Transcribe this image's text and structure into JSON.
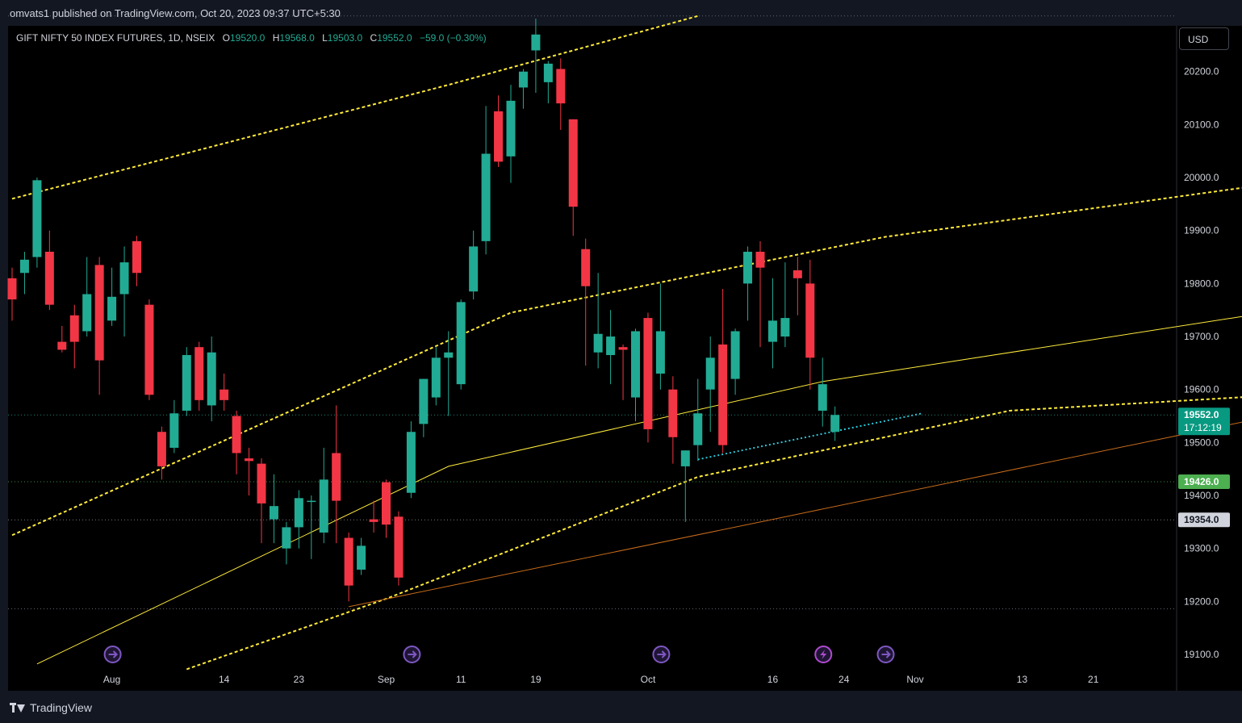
{
  "header": {
    "publisher": "omvats1 published on TradingView.com, Oct 20, 2023 09:37 UTC+5:30"
  },
  "legend": {
    "symbol": "GIFT NIFTY 50 INDEX FUTURES, 1D, NSEIX",
    "o_label": "O",
    "o": "19520.0",
    "h_label": "H",
    "h": "19568.0",
    "l_label": "L",
    "l": "19503.0",
    "c_label": "C",
    "c": "19552.0",
    "change": "−59.0 (−0.30%)"
  },
  "toolbar": {
    "currency": "USD"
  },
  "footer": {
    "brand": "TradingView"
  },
  "colors": {
    "up": "#22ab94",
    "down": "#f23645",
    "background": "#000000",
    "frame": "#131722",
    "channel": "#ffeb3b",
    "trend_cyan": "#2ec4d6",
    "trend_orange": "#c76b1a"
  },
  "chart_data": {
    "type": "candlestick",
    "title": "GIFT NIFTY 50 INDEX FUTURES, 1D, NSEIX",
    "ylim": [
      19055,
      20320
    ],
    "y_ticks": [
      19100,
      19200,
      19300,
      19400,
      19500,
      19600,
      19700,
      19800,
      19900,
      20000,
      20100,
      20200
    ],
    "y_tick_labels": [
      "19100.0",
      "19200.0",
      "19300.0",
      "19400.0",
      "19500.0",
      "19600.0",
      "19700.0",
      "19800.0",
      "19900.0",
      "20000.0",
      "20100.0",
      "20200.0"
    ],
    "x_tick_labels": [
      {
        "label": "Aug",
        "date": "2023-08-01"
      },
      {
        "label": "14",
        "date": "2023-08-14"
      },
      {
        "label": "23",
        "date": "2023-08-23"
      },
      {
        "label": "Sep",
        "date": "2023-09-01"
      },
      {
        "label": "11",
        "date": "2023-09-11"
      },
      {
        "label": "19",
        "date": "2023-09-19"
      },
      {
        "label": "Oct",
        "date": "2023-10-02"
      },
      {
        "label": "16",
        "date": "2023-10-16"
      },
      {
        "label": "24",
        "date": "2023-10-24"
      },
      {
        "label": "Nov",
        "date": "2023-11-01"
      },
      {
        "label": "13",
        "date": "2023-11-13"
      },
      {
        "label": "21",
        "date": "2023-11-21"
      }
    ],
    "candles": [
      {
        "date": "2023-07-20",
        "o": 19810,
        "h": 19830,
        "l": 19730,
        "c": 19770
      },
      {
        "date": "2023-07-21",
        "o": 19820,
        "h": 19860,
        "l": 19780,
        "c": 19845
      },
      {
        "date": "2023-07-24",
        "o": 19850,
        "h": 20000,
        "l": 19830,
        "c": 19995
      },
      {
        "date": "2023-07-25",
        "o": 19860,
        "h": 19900,
        "l": 19750,
        "c": 19760
      },
      {
        "date": "2023-07-26",
        "o": 19690,
        "h": 19720,
        "l": 19670,
        "c": 19675
      },
      {
        "date": "2023-07-27",
        "o": 19740,
        "h": 19760,
        "l": 19640,
        "c": 19690
      },
      {
        "date": "2023-07-28",
        "o": 19710,
        "h": 19850,
        "l": 19700,
        "c": 19780
      },
      {
        "date": "2023-07-31",
        "o": 19835,
        "h": 19850,
        "l": 19590,
        "c": 19655
      },
      {
        "date": "2023-08-01",
        "o": 19730,
        "h": 19830,
        "l": 19720,
        "c": 19775
      },
      {
        "date": "2023-08-02",
        "o": 19780,
        "h": 19870,
        "l": 19700,
        "c": 19840
      },
      {
        "date": "2023-08-03",
        "o": 19880,
        "h": 19890,
        "l": 19795,
        "c": 19820
      },
      {
        "date": "2023-08-04",
        "o": 19760,
        "h": 19770,
        "l": 19580,
        "c": 19590
      },
      {
        "date": "2023-08-07",
        "o": 19520,
        "h": 19530,
        "l": 19430,
        "c": 19455
      },
      {
        "date": "2023-08-08",
        "o": 19490,
        "h": 19580,
        "l": 19480,
        "c": 19555
      },
      {
        "date": "2023-08-09",
        "o": 19560,
        "h": 19680,
        "l": 19550,
        "c": 19665
      },
      {
        "date": "2023-08-10",
        "o": 19680,
        "h": 19690,
        "l": 19560,
        "c": 19580
      },
      {
        "date": "2023-08-11",
        "o": 19570,
        "h": 19700,
        "l": 19540,
        "c": 19670
      },
      {
        "date": "2023-08-14",
        "o": 19600,
        "h": 19630,
        "l": 19560,
        "c": 19580
      },
      {
        "date": "2023-08-16",
        "o": 19550,
        "h": 19560,
        "l": 19440,
        "c": 19480
      },
      {
        "date": "2023-08-17",
        "o": 19470,
        "h": 19490,
        "l": 19400,
        "c": 19465
      },
      {
        "date": "2023-08-18",
        "o": 19460,
        "h": 19470,
        "l": 19310,
        "c": 19385
      },
      {
        "date": "2023-08-21",
        "o": 19355,
        "h": 19440,
        "l": 19310,
        "c": 19380
      },
      {
        "date": "2023-08-22",
        "o": 19300,
        "h": 19350,
        "l": 19270,
        "c": 19340
      },
      {
        "date": "2023-08-23",
        "o": 19340,
        "h": 19410,
        "l": 19300,
        "c": 19395
      },
      {
        "date": "2023-08-24",
        "o": 19390,
        "h": 19400,
        "l": 19280,
        "c": 19390
      },
      {
        "date": "2023-08-25",
        "o": 19330,
        "h": 19490,
        "l": 19310,
        "c": 19430
      },
      {
        "date": "2023-08-28",
        "o": 19480,
        "h": 19570,
        "l": 19310,
        "c": 19390
      },
      {
        "date": "2023-08-29",
        "o": 19320,
        "h": 19330,
        "l": 19200,
        "c": 19230
      },
      {
        "date": "2023-08-30",
        "o": 19260,
        "h": 19320,
        "l": 19250,
        "c": 19305
      },
      {
        "date": "2023-08-31",
        "o": 19355,
        "h": 19390,
        "l": 19330,
        "c": 19350
      },
      {
        "date": "2023-09-01",
        "o": 19425,
        "h": 19430,
        "l": 19320,
        "c": 19345
      },
      {
        "date": "2023-09-04",
        "o": 19360,
        "h": 19370,
        "l": 19230,
        "c": 19245
      },
      {
        "date": "2023-09-05",
        "o": 19405,
        "h": 19540,
        "l": 19395,
        "c": 19520
      },
      {
        "date": "2023-09-06",
        "o": 19535,
        "h": 19620,
        "l": 19510,
        "c": 19620
      },
      {
        "date": "2023-09-07",
        "o": 19585,
        "h": 19680,
        "l": 19570,
        "c": 19660
      },
      {
        "date": "2023-09-08",
        "o": 19660,
        "h": 19710,
        "l": 19550,
        "c": 19670
      },
      {
        "date": "2023-09-11",
        "o": 19610,
        "h": 19770,
        "l": 19600,
        "c": 19765
      },
      {
        "date": "2023-09-12",
        "o": 19785,
        "h": 19900,
        "l": 19770,
        "c": 19870
      },
      {
        "date": "2023-09-13",
        "o": 19880,
        "h": 20135,
        "l": 19855,
        "c": 20045
      },
      {
        "date": "2023-09-14",
        "o": 20125,
        "h": 20155,
        "l": 20020,
        "c": 20030
      },
      {
        "date": "2023-09-15",
        "o": 20040,
        "h": 20175,
        "l": 19990,
        "c": 20145
      },
      {
        "date": "2023-09-18",
        "o": 20170,
        "h": 20205,
        "l": 20130,
        "c": 20200
      },
      {
        "date": "2023-09-19",
        "o": 20240,
        "h": 20300,
        "l": 20160,
        "c": 20270
      },
      {
        "date": "2023-09-20",
        "o": 20180,
        "h": 20220,
        "l": 20140,
        "c": 20215
      },
      {
        "date": "2023-09-21",
        "o": 20205,
        "h": 20225,
        "l": 20090,
        "c": 20140
      },
      {
        "date": "2023-09-22",
        "o": 20110,
        "h": 20110,
        "l": 19890,
        "c": 19945
      },
      {
        "date": "2023-09-25",
        "o": 19865,
        "h": 19885,
        "l": 19645,
        "c": 19795
      },
      {
        "date": "2023-09-26",
        "o": 19670,
        "h": 19820,
        "l": 19640,
        "c": 19705
      },
      {
        "date": "2023-09-27",
        "o": 19665,
        "h": 19750,
        "l": 19610,
        "c": 19700
      },
      {
        "date": "2023-09-28",
        "o": 19680,
        "h": 19685,
        "l": 19580,
        "c": 19675
      },
      {
        "date": "2023-09-29",
        "o": 19585,
        "h": 19715,
        "l": 19540,
        "c": 19710
      },
      {
        "date": "2023-10-02",
        "o": 19735,
        "h": 19745,
        "l": 19500,
        "c": 19525
      },
      {
        "date": "2023-10-03",
        "o": 19630,
        "h": 19800,
        "l": 19600,
        "c": 19710
      },
      {
        "date": "2023-10-04",
        "o": 19600,
        "h": 19625,
        "l": 19460,
        "c": 19510
      },
      {
        "date": "2023-10-05",
        "o": 19455,
        "h": 19485,
        "l": 19350,
        "c": 19485
      },
      {
        "date": "2023-10-06",
        "o": 19495,
        "h": 19620,
        "l": 19465,
        "c": 19555
      },
      {
        "date": "2023-10-09",
        "o": 19600,
        "h": 19700,
        "l": 19520,
        "c": 19660
      },
      {
        "date": "2023-10-10",
        "o": 19685,
        "h": 19790,
        "l": 19480,
        "c": 19495
      },
      {
        "date": "2023-10-11",
        "o": 19620,
        "h": 19715,
        "l": 19590,
        "c": 19710
      },
      {
        "date": "2023-10-12",
        "o": 19800,
        "h": 19870,
        "l": 19730,
        "c": 19860
      },
      {
        "date": "2023-10-13",
        "o": 19860,
        "h": 19880,
        "l": 19680,
        "c": 19830
      },
      {
        "date": "2023-10-16",
        "o": 19690,
        "h": 19810,
        "l": 19640,
        "c": 19730
      },
      {
        "date": "2023-10-17",
        "o": 19700,
        "h": 19840,
        "l": 19680,
        "c": 19735
      },
      {
        "date": "2023-10-18",
        "o": 19825,
        "h": 19850,
        "l": 19740,
        "c": 19810
      },
      {
        "date": "2023-10-19",
        "o": 19800,
        "h": 19845,
        "l": 19600,
        "c": 19660
      },
      {
        "date": "2023-10-20",
        "o": 19560,
        "h": 19660,
        "l": 19530,
        "c": 19610
      },
      {
        "date": "2023-10-23",
        "o": 19520,
        "h": 19568,
        "l": 19503,
        "c": 19552
      }
    ],
    "price_labels": [
      {
        "value": 19552,
        "text": "19552.0",
        "sub": "17:12:19",
        "kind": "last"
      },
      {
        "value": 19426,
        "text": "19426.0",
        "kind": "green"
      },
      {
        "value": 19354,
        "text": "19354.0",
        "kind": "gray"
      }
    ],
    "horizontal_levels": [
      19552,
      19426,
      19354,
      19186,
      20305
    ],
    "channel_lines": [
      {
        "style": "dashed",
        "width": 2,
        "points": [
          [
            0,
            19960
          ],
          [
            35,
            20175
          ],
          [
            55,
            20305
          ]
        ]
      },
      {
        "style": "dashed",
        "width": 2,
        "points": [
          [
            0,
            19325
          ],
          [
            40,
            19745
          ],
          [
            70,
            19888
          ],
          [
            100,
            19985
          ]
        ]
      },
      {
        "style": "dashed",
        "width": 2,
        "points": [
          [
            14,
            19072
          ],
          [
            30,
            19205
          ],
          [
            55,
            19435
          ],
          [
            80,
            19560
          ],
          [
            102,
            19590
          ]
        ]
      },
      {
        "style": "solid",
        "width": 1,
        "points": [
          [
            2,
            19082
          ],
          [
            35,
            19455
          ],
          [
            65,
            19615
          ],
          [
            102,
            19750
          ]
        ]
      },
      {
        "style": "solid",
        "width": 1,
        "color": "orange",
        "points": [
          [
            27,
            19190
          ],
          [
            60,
            19350
          ],
          [
            100,
            19545
          ]
        ]
      }
    ],
    "cyan_trendline": [
      [
        55,
        19468
      ],
      [
        73,
        19555
      ]
    ],
    "event_markers": [
      {
        "index": 8,
        "type": "dividend"
      },
      {
        "index": 32,
        "type": "dividend"
      },
      {
        "index": 52,
        "type": "dividend"
      },
      {
        "index": 65,
        "type": "earnings"
      },
      {
        "index": 70,
        "type": "dividend"
      }
    ]
  }
}
